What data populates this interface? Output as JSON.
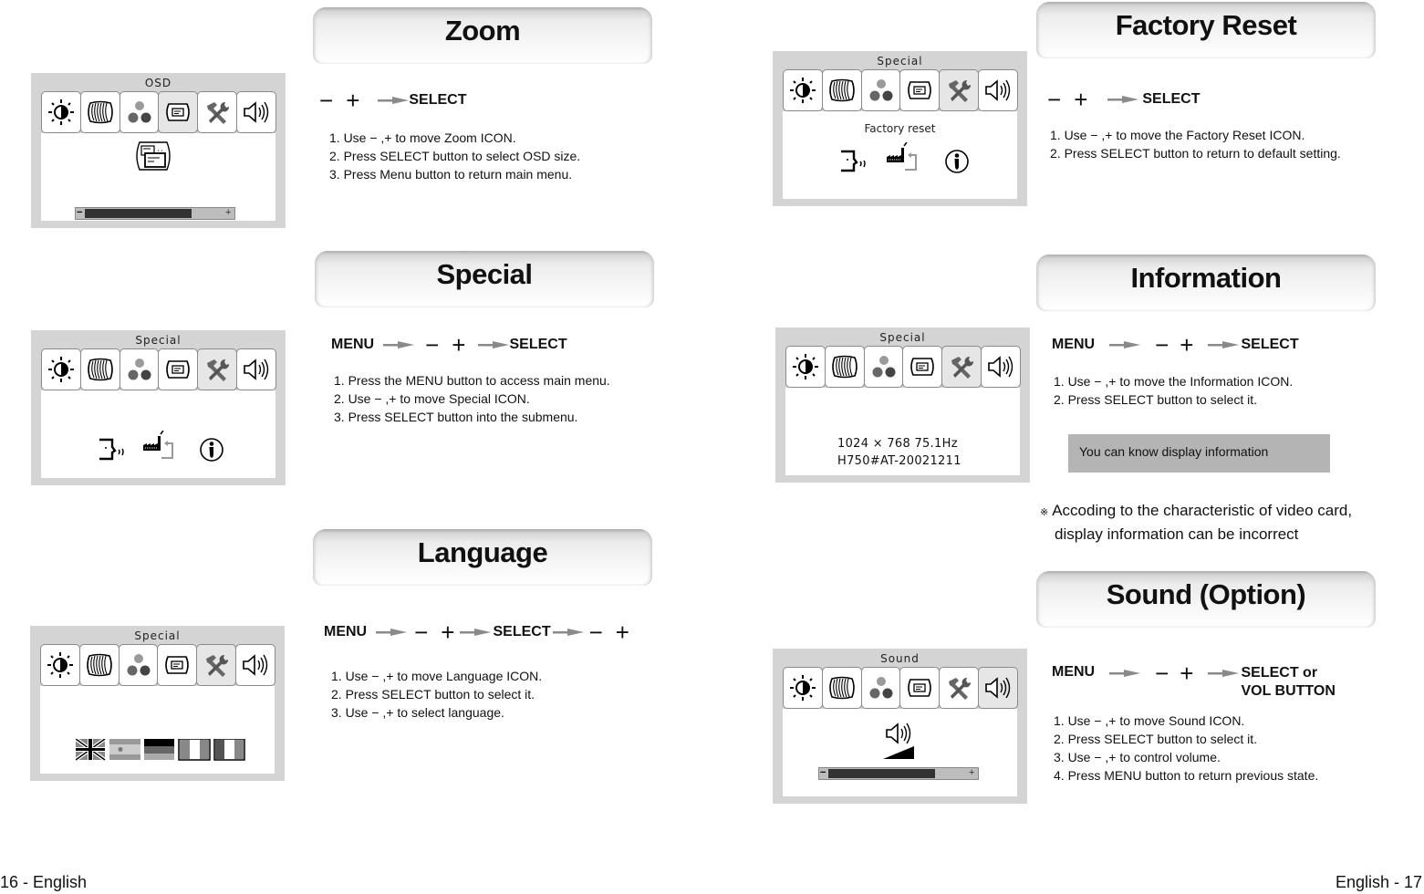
{
  "pages": {
    "left_footer": "16 - English",
    "right_footer": "English - 17"
  },
  "osd_tabs": [
    {
      "icon": "brightness-contrast-icon"
    },
    {
      "icon": "geometry-icon"
    },
    {
      "icon": "color-icon"
    },
    {
      "icon": "osd-icon"
    },
    {
      "icon": "special-tools-icon"
    },
    {
      "icon": "sound-icon"
    }
  ],
  "sections": {
    "zoom": {
      "title": "Zoom",
      "osd_title": "OSD",
      "active_tab": 3,
      "slider_value_percent": 76,
      "nav": {
        "minus": "−",
        "plus": "+",
        "select": "SELECT"
      },
      "steps": [
        "1. Use  − ,+ to move Zoom ICON.",
        "2. Press SELECT button to select OSD size.",
        "3. Press Menu button to return main menu."
      ]
    },
    "special": {
      "title": "Special",
      "osd_title": "Special",
      "active_tab": 4,
      "sub_icons": [
        "language-icon",
        "factory-reset-icon",
        "information-icon"
      ],
      "nav": {
        "menu": "MENU",
        "minus": "−",
        "plus": "+",
        "select": "SELECT"
      },
      "steps": [
        "1. Press the MENU button to access main menu.",
        "2. Use  − ,+ to move Special ICON.",
        "3. Press SELECT button into the submenu."
      ]
    },
    "language": {
      "title": "Language",
      "osd_title": "Special",
      "active_tab": 4,
      "flags": [
        "english-flag",
        "spanish-flag",
        "german-flag",
        "french-flag",
        "italian-flag"
      ],
      "nav": {
        "menu": "MENU",
        "minus": "−",
        "plus": "+",
        "select": "SELECT",
        "minus2": "−",
        "plus2": "+"
      },
      "steps": [
        "1. Use  − ,+ to move Language ICON.",
        "2. Press SELECT button to select it.",
        "3. Use  − ,+ to select language."
      ]
    },
    "factory_reset": {
      "title": "Factory Reset",
      "osd_title": "Special",
      "active_tab": 4,
      "osd_label": "Factory reset",
      "nav": {
        "minus": "−",
        "plus": "+",
        "select": "SELECT"
      },
      "steps": [
        "1. Use  − ,+ to move the Factory Reset ICON.",
        "2. Press SELECT button to return to default setting."
      ]
    },
    "information": {
      "title": "Information",
      "osd_title": "Special",
      "active_tab": 4,
      "osd_lines": [
        "1024 ×  768 75.1Hz",
        "H750#AT-20021211"
      ],
      "nav": {
        "menu": "MENU",
        "minus": "−",
        "plus": "+",
        "select": "SELECT"
      },
      "steps": [
        "1. Use  − ,+ to move the Information ICON.",
        "2. Press SELECT button to select it."
      ],
      "info_box": "You can know display information",
      "note_mark": "※",
      "note_lines": [
        "Accoding to the characteristic of video card,",
        "display information can be incorrect"
      ]
    },
    "sound": {
      "title": "Sound (Option)",
      "osd_title": "Sound",
      "active_tab": 5,
      "slider_value_percent": 76,
      "nav": {
        "menu": "MENU",
        "minus": "−",
        "plus": "+",
        "select_line1": "SELECT or",
        "select_line2": "VOL BUTTON"
      },
      "steps": [
        "1. Use  − ,+ to move Sound ICON.",
        "2. Press SELECT button to select it.",
        "3. Use  − ,+ to control volume.",
        "4. Press MENU button to return previous state."
      ]
    }
  }
}
